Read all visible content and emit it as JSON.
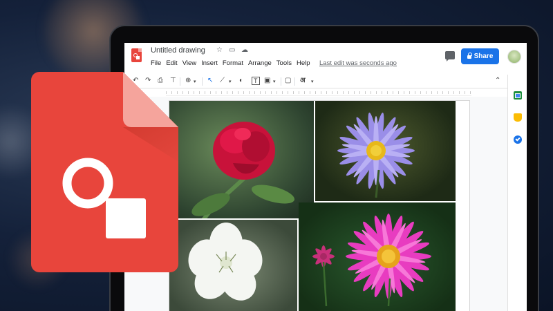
{
  "app": {
    "title": "Untitled drawing",
    "last_edit": "Last edit was seconds ago",
    "share_label": "Share"
  },
  "menu": [
    "File",
    "Edit",
    "View",
    "Insert",
    "Format",
    "Arrange",
    "Tools",
    "Help"
  ],
  "toolbar": {
    "input_tool_glyph": "अ"
  },
  "icons": {
    "star": "☆",
    "folder": "▭",
    "cloud": "☁",
    "undo": "↶",
    "redo": "↷",
    "print": "⎙",
    "paint": "⊤",
    "zoom": "⊕",
    "caret": "▾",
    "select": "↖",
    "line": "⟋",
    "shape": "◐",
    "textbox": "T",
    "image": "▣",
    "comment": "▢",
    "collapse": "⌃"
  },
  "colors": {
    "brand_red": "#e8453c",
    "share_blue": "#1a73e8"
  }
}
